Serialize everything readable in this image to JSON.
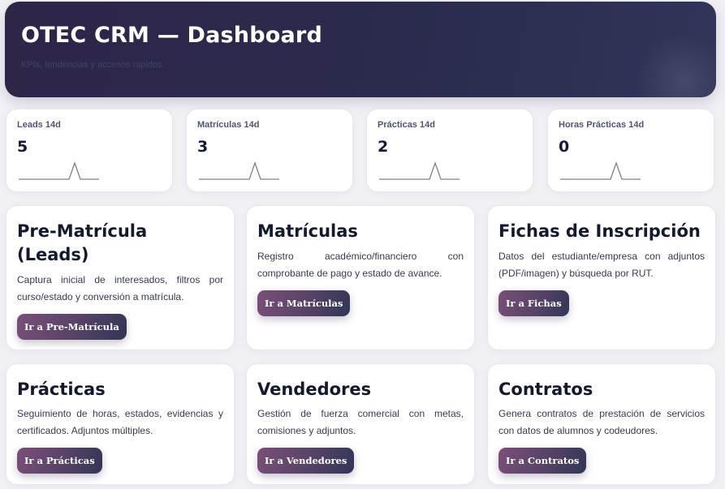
{
  "header": {
    "title": "OTEC CRM — Dashboard",
    "subtitle": "KPIs, tendencias y accesos rápidos."
  },
  "kpis": [
    {
      "label": "Leads 14d",
      "value": "5"
    },
    {
      "label": "Matrículas 14d",
      "value": "3"
    },
    {
      "label": "Prácticas 14d",
      "value": "2"
    },
    {
      "label": "Horas Prácticas 14d",
      "value": "0"
    }
  ],
  "cards": [
    {
      "title": "Pre-Matrícula (Leads)",
      "desc": "Captura inicial de interesados, filtros por curso/estado y conversión a matrícula.",
      "button": "Ir a Pre-Matrícula"
    },
    {
      "title": "Matrículas",
      "desc": "Registro académico/financiero con comprobante de pago y estado de avance.",
      "button": "Ir a Matrículas"
    },
    {
      "title": "Fichas de Inscripción",
      "desc": "Datos del estudiante/empresa con adjuntos (PDF/imagen) y búsqueda por RUT.",
      "button": "Ir a Fichas"
    },
    {
      "title": "Prácticas",
      "desc": "Seguimiento de horas, estados, evidencias y certificados. Adjuntos múltiples.",
      "button": "Ir a Prácticas"
    },
    {
      "title": "Vendedores",
      "desc": "Gestión de fuerza comercial con metas, comisiones y adjuntos.",
      "button": "Ir a Vendedores"
    },
    {
      "title": "Contratos",
      "desc": "Genera contratos de prestación de servicios con datos de alumnos y codeudores.",
      "button": "Ir a Contratos"
    }
  ],
  "colors": {
    "header_bg": "#2a2b4d",
    "button_start": "#7a4f78",
    "button_end": "#323656",
    "sparkline": "#7a8193"
  }
}
